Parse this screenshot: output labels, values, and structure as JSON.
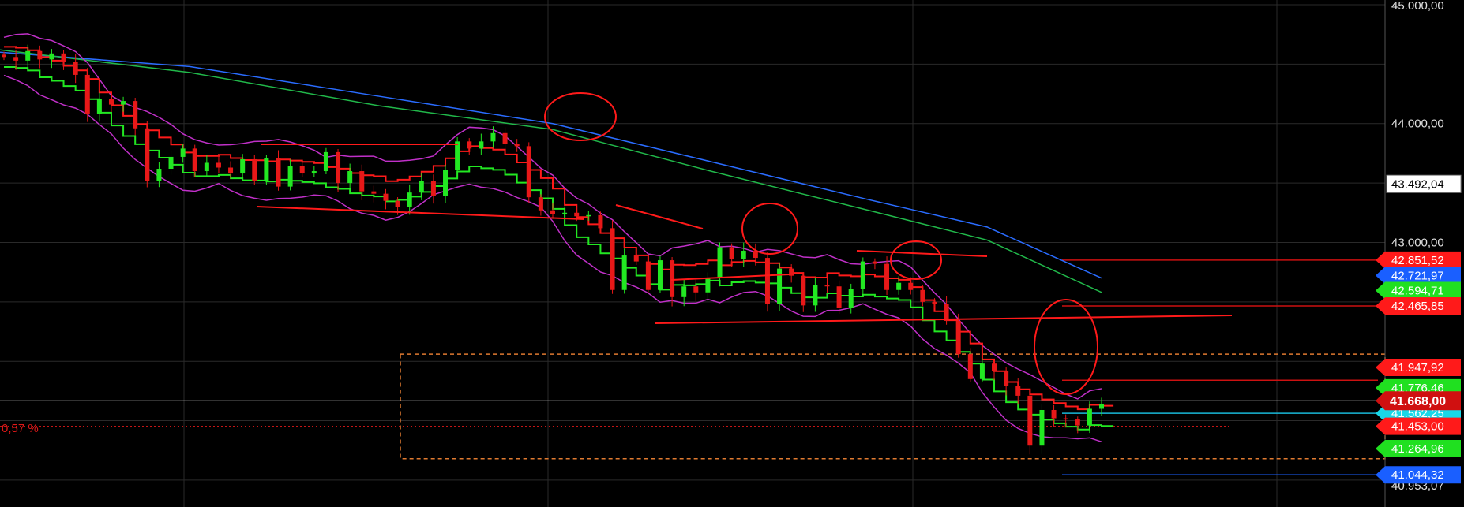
{
  "chart_data": {
    "type": "candlestick",
    "title": "",
    "xlabel": "",
    "ylabel": "",
    "ylim": [
      40900,
      45060
    ],
    "grid": true,
    "price_axis": {
      "side": "right",
      "ticks": [
        "45.000,00",
        "44.000,00",
        "43.000,00",
        "40.953,07"
      ],
      "tick_values": [
        45000,
        44000,
        43000,
        40953.07
      ]
    },
    "current_price": {
      "label": "41.668,00",
      "value": 41668
    },
    "markers": [
      {
        "label": "43.492,04",
        "value": 43492.04,
        "color": "#ffffff"
      },
      {
        "label": "42.851,52",
        "value": 42851.52,
        "color": "#ff1a1a"
      },
      {
        "label": "42.721,97",
        "value": 42721.97,
        "color": "#1a5fff"
      },
      {
        "label": "42.594,71",
        "value": 42594.71,
        "color": "#20e020"
      },
      {
        "label": "42.465,85",
        "value": 42465.85,
        "color": "#ff1a1a"
      },
      {
        "label": "41.947,92",
        "value": 41947.92,
        "color": "#ff1a1a"
      },
      {
        "label": "41.776,46",
        "value": 41776.46,
        "color": "#20e020"
      },
      {
        "label": "41.562,25",
        "value": 41562.25,
        "color": "#18d8e8"
      },
      {
        "label": "41.453,00",
        "value": 41453,
        "color": "#ff1a1a"
      },
      {
        "label": "41.264,96",
        "value": 41264.96,
        "color": "#20e020"
      },
      {
        "label": "41.044,32",
        "value": 41044.32,
        "color": "#1a5fff"
      }
    ],
    "percent_label": {
      "label": "0,57 %",
      "value": 41453
    },
    "horizontal_lines": [
      {
        "value": 42851.52,
        "color": "#cc1111"
      },
      {
        "value": 42465.85,
        "color": "#cc1111"
      },
      {
        "value": 41840,
        "color": "#cc1111"
      },
      {
        "value": 41562.25,
        "color": "#18b8d8"
      },
      {
        "value": 41044.32,
        "color": "#1a5fff"
      }
    ],
    "zone_box": {
      "top": 42060,
      "bottom": 41180,
      "color": "#e07a30"
    },
    "close_series": [
      44560,
      44530,
      44610,
      44540,
      44590,
      44520,
      44410,
      44080,
      44210,
      44160,
      44190,
      43960,
      43520,
      43620,
      43720,
      43790,
      43600,
      43670,
      43630,
      43580,
      43700,
      43520,
      43710,
      43470,
      43640,
      43580,
      43600,
      43760,
      43500,
      43600,
      43430,
      43410,
      43350,
      43300,
      43420,
      43520,
      43390,
      43610,
      43850,
      43790,
      43850,
      43920,
      43830,
      43810,
      43380,
      43270,
      43240,
      43250,
      43220,
      43230,
      43120,
      42600,
      42890,
      42840,
      42600,
      42850,
      42540,
      42630,
      42580,
      42700,
      42960,
      42860,
      42930,
      42870,
      42480,
      42780,
      42720,
      42470,
      42640,
      42630,
      42450,
      42610,
      42840,
      42820,
      42600,
      42660,
      42600,
      42500,
      42480,
      42340,
      42060,
      41850,
      41980,
      41920,
      41790,
      41710,
      41290,
      41590,
      41520,
      41510,
      41460,
      41600,
      41640
    ]
  }
}
